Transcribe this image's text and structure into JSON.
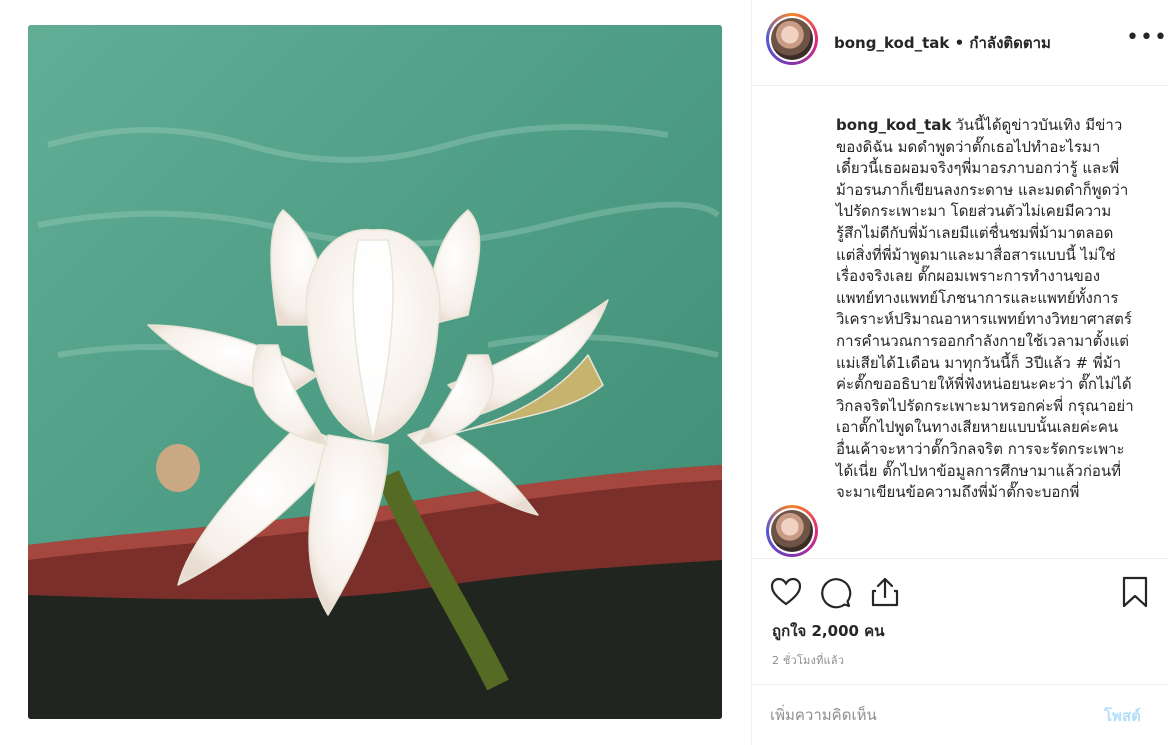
{
  "post": {
    "username": "bong_kod_tak",
    "separator": " • ",
    "follow_state": "กำลังติดตาม",
    "more_icon": "more-options-icon",
    "caption_text": "วันนี้ได้ดูข่าวบันเทิง มีข่าวของดิฉัน มดดำพูดว่าตั๊กเธอไปทำอะไรมา เดี๋ยวนี้เธอผอมจริงๆพี่มาอรภาบอกว่ารู้ และพี่ม้าอรนภาก็เขียนลงกระดาษ และมดดำก็พูดว่าไปรัดกระเพาะมา โดยส่วนตัวไม่เคยมีความรู้สึกไม่ดีกับพี่ม้าเลยมีแต่ชื่นชมพี่ม้ามาตลอด แต่สิ่งที่พี่ม้าพูดมาและมาสื่อสารแบบนี้ ไม่ใช่เรื่องจริงเลย ตั๊กผอมเพราะการทำงานของแพทย์ทางแพทย์โภชนาการและแพทย์ทั้งการวิเคราะห์ปริมาณอาหารแพทย์ทางวิทยาศาสตร์การคำนวณการออกกำลังกายใช้เวลามาตั้งแต่แม่เสียได้1เดือน มาทุกวันนี้ก็ 3ปีแล้ว # พี่ม้าค่ะตั๊กขออธิบายให้พี่ฟังหน่อยนะคะว่า ตั๊กไม่ได้ วิกลจริตไปรัดกระเพาะมาหรอกค่ะพี่ กรุณาอย่าเอาตั๊กไปพูดในทางเสียหายแบบนั้นเลยค่ะคนอื่นเค้าจะหาว่าตั๊กวิกลจริต การจะรัดกระเพาะได้เนี่ย ตั๊กไปหาข้อมูลการศึกษามาแล้วก่อนที่จะมาเขียนข้อความถึงพี่ม้าตั๊กจะบอกพี่",
    "likes_text": "ถูกใจ 2,000 คน",
    "timestamp": "2 ชั่วโมงที่แล้ว",
    "comment_placeholder": "เพิ่มความคิดเห็น",
    "post_button": "โพสต์"
  },
  "icons": {
    "like": "heart-icon",
    "comment": "comment-icon",
    "share": "share-icon",
    "save": "bookmark-icon"
  },
  "colors": {
    "text": "#262626",
    "muted": "#8e8e8e",
    "post_button_disabled": "#b2dffc",
    "divider": "#efefef"
  }
}
